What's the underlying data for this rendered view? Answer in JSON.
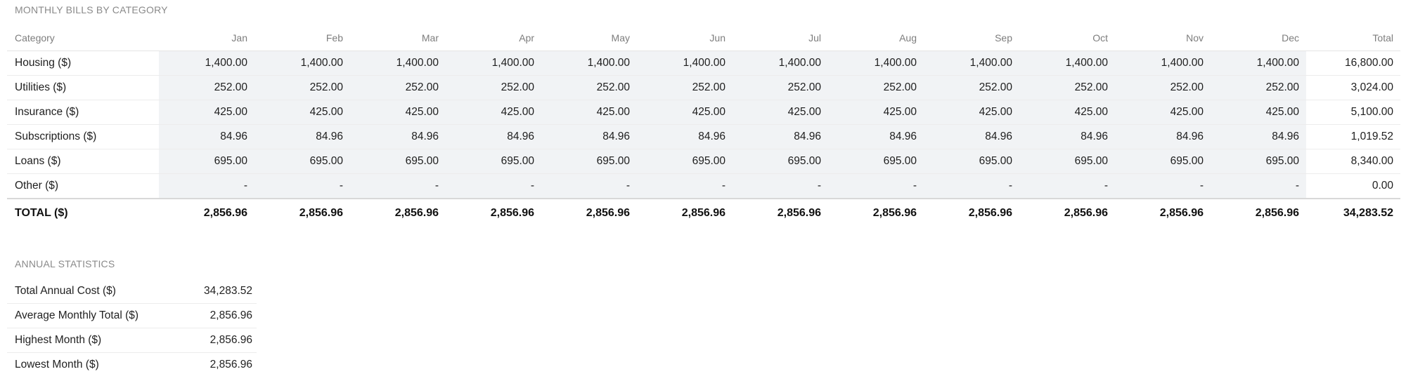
{
  "bills": {
    "title": "MONTHLY BILLS BY CATEGORY",
    "header": {
      "category": "Category",
      "months": [
        "Jan",
        "Feb",
        "Mar",
        "Apr",
        "May",
        "Jun",
        "Jul",
        "Aug",
        "Sep",
        "Oct",
        "Nov",
        "Dec"
      ],
      "total": "Total"
    },
    "rows": [
      {
        "category": "Housing ($)",
        "values": [
          "1,400.00",
          "1,400.00",
          "1,400.00",
          "1,400.00",
          "1,400.00",
          "1,400.00",
          "1,400.00",
          "1,400.00",
          "1,400.00",
          "1,400.00",
          "1,400.00",
          "1,400.00"
        ],
        "total": "16,800.00"
      },
      {
        "category": "Utilities ($)",
        "values": [
          "252.00",
          "252.00",
          "252.00",
          "252.00",
          "252.00",
          "252.00",
          "252.00",
          "252.00",
          "252.00",
          "252.00",
          "252.00",
          "252.00"
        ],
        "total": "3,024.00"
      },
      {
        "category": "Insurance ($)",
        "values": [
          "425.00",
          "425.00",
          "425.00",
          "425.00",
          "425.00",
          "425.00",
          "425.00",
          "425.00",
          "425.00",
          "425.00",
          "425.00",
          "425.00"
        ],
        "total": "5,100.00"
      },
      {
        "category": "Subscriptions ($)",
        "values": [
          "84.96",
          "84.96",
          "84.96",
          "84.96",
          "84.96",
          "84.96",
          "84.96",
          "84.96",
          "84.96",
          "84.96",
          "84.96",
          "84.96"
        ],
        "total": "1,019.52"
      },
      {
        "category": "Loans ($)",
        "values": [
          "695.00",
          "695.00",
          "695.00",
          "695.00",
          "695.00",
          "695.00",
          "695.00",
          "695.00",
          "695.00",
          "695.00",
          "695.00",
          "695.00"
        ],
        "total": "8,340.00"
      },
      {
        "category": "Other ($)",
        "values": [
          "-",
          "-",
          "-",
          "-",
          "-",
          "-",
          "-",
          "-",
          "-",
          "-",
          "-",
          "-"
        ],
        "total": "0.00"
      }
    ],
    "totals_row": {
      "label": "TOTAL ($)",
      "values": [
        "2,856.96",
        "2,856.96",
        "2,856.96",
        "2,856.96",
        "2,856.96",
        "2,856.96",
        "2,856.96",
        "2,856.96",
        "2,856.96",
        "2,856.96",
        "2,856.96",
        "2,856.96"
      ],
      "total": "34,283.52"
    }
  },
  "stats": {
    "title": "ANNUAL STATISTICS",
    "rows": [
      {
        "label": "Total Annual Cost ($)",
        "value": "34,283.52"
      },
      {
        "label": "Average Monthly Total ($)",
        "value": "2,856.96"
      },
      {
        "label": "Highest Month ($)",
        "value": "2,856.96"
      },
      {
        "label": "Lowest Month ($)",
        "value": "2,856.96"
      }
    ]
  },
  "colors": {
    "month_cell_bg": "#f1f3f5",
    "header_text": "#7d7d7d",
    "section_title": "#8a8a8a"
  }
}
